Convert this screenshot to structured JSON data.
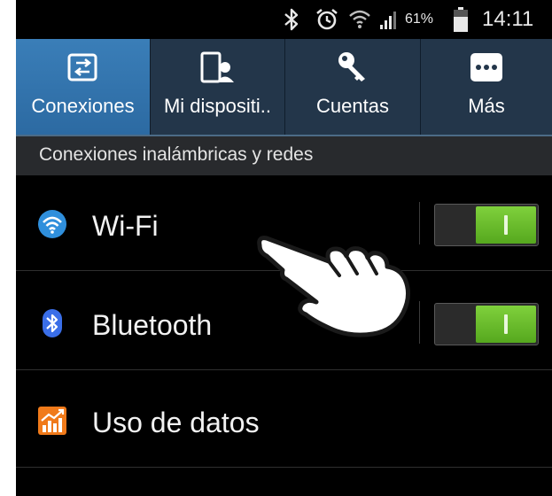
{
  "status_bar": {
    "battery_percent": "61%",
    "time": "14:11",
    "icons": [
      "bluetooth-icon",
      "alarm-icon",
      "wifi-icon",
      "signal-icon",
      "battery-icon"
    ]
  },
  "tabs": [
    {
      "label": "Conexiones",
      "icon": "connections-icon",
      "active": true
    },
    {
      "label": "Mi dispositi..",
      "icon": "device-icon",
      "active": false
    },
    {
      "label": "Cuentas",
      "icon": "key-icon",
      "active": false
    },
    {
      "label": "Más",
      "icon": "more-icon",
      "active": false
    }
  ],
  "section_header": "Conexiones inalámbricas y redes",
  "rows": [
    {
      "label": "Wi-Fi",
      "icon": "wifi-icon",
      "toggle": "on"
    },
    {
      "label": "Bluetooth",
      "icon": "bluetooth-icon",
      "toggle": "on"
    },
    {
      "label": "Uso de datos",
      "icon": "data-usage-icon"
    }
  ],
  "overlay": {
    "icon": "pointing-hand-icon"
  },
  "colors": {
    "active_tab": "#3a7eb8",
    "tab_bar": "#23364a",
    "toggle_on": "#6cc22e",
    "background": "#000000"
  }
}
